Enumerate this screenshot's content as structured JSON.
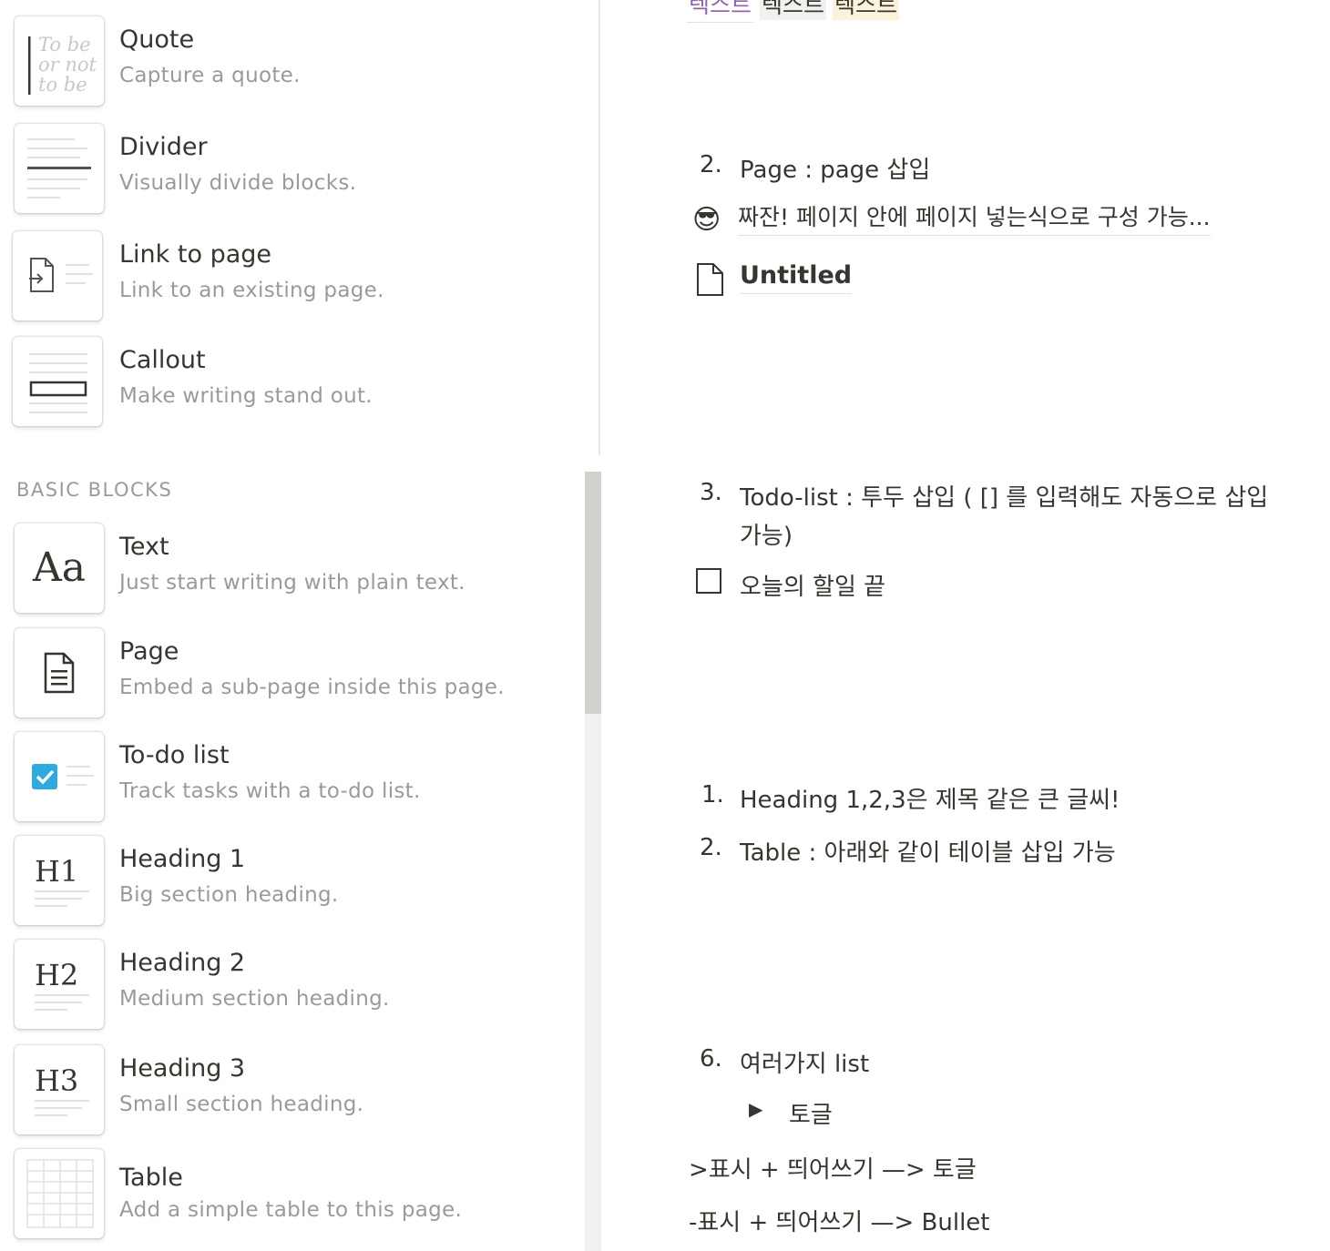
{
  "top_texts": [
    {
      "text": "텍스트",
      "color": "#9065b0",
      "bg": "#ffffff",
      "underline": true
    },
    {
      "text": "텍스트",
      "color": "#37352f",
      "bg": "#f1f1ef",
      "underline": false
    },
    {
      "text": "텍스트",
      "color": "#37352f",
      "bg": "#fbf3db",
      "underline": false
    }
  ],
  "menu_top": [
    {
      "title": "Quote",
      "desc": "Capture a quote.",
      "icon": "quote-icon"
    },
    {
      "title": "Divider",
      "desc": "Visually divide blocks.",
      "icon": "divider-icon"
    },
    {
      "title": "Link to page",
      "desc": "Link to an existing page.",
      "icon": "link-page-icon"
    },
    {
      "title": "Callout",
      "desc": "Make writing stand out.",
      "icon": "callout-icon"
    }
  ],
  "quote_thumb_text": [
    "To be",
    "or not",
    "to be"
  ],
  "section_label": "BASIC BLOCKS",
  "menu_basic": [
    {
      "title": "Text",
      "desc": "Just start writing with plain text.",
      "icon": "text-icon",
      "glyph": "Aa"
    },
    {
      "title": "Page",
      "desc": "Embed a sub-page inside this page.",
      "icon": "page-icon"
    },
    {
      "title": "To-do list",
      "desc": "Track tasks with a to-do list.",
      "icon": "todo-icon"
    },
    {
      "title": "Heading 1",
      "desc": "Big section heading.",
      "icon": "heading1-icon",
      "glyph": "H1"
    },
    {
      "title": "Heading 2",
      "desc": "Medium section heading.",
      "icon": "heading2-icon",
      "glyph": "H2"
    },
    {
      "title": "Heading 3",
      "desc": "Small section heading.",
      "icon": "heading3-icon",
      "glyph": "H3"
    },
    {
      "title": "Table",
      "desc": "Add a simple table to this page.",
      "icon": "table-icon"
    }
  ],
  "content": {
    "page_item": {
      "num": "2.",
      "text": "Page : page 삽입"
    },
    "subpage_link": {
      "emoji": "😎",
      "text": "짜잔! 페이지 안에 페이지 넣는식으로 구성 가능..."
    },
    "untitled_link": {
      "icon": "page-doc-icon",
      "text": "Untitled"
    },
    "todo_item": {
      "num": "3.",
      "line1": "Todo-list : 투두 삽입 ( [] 를 입력해도 자동으로 삽입",
      "line2": "가능)"
    },
    "todo_checkbox": {
      "text": "오늘의 할일 끝",
      "checked": false
    },
    "heading_item": {
      "num": "1.",
      "text": "Heading 1,2,3은 제목 같은 큰 글씨!"
    },
    "table_item": {
      "num": "2.",
      "text": "Table : 아래와 같이 테이블 삽입 가능"
    },
    "list_item": {
      "num": "6.",
      "text": "여러가지 list"
    },
    "toggle": {
      "arrow": "▶",
      "text": "토글"
    },
    "note1": ">표시 + 띄어쓰기 —> 토글",
    "note2": "-표시 + 띄어쓰기 —> Bullet"
  },
  "colors": {
    "accent": "#2eaadc",
    "muted": "#9b9a97",
    "text": "#37352f",
    "scroll_thumb": "#d3d1cb"
  }
}
